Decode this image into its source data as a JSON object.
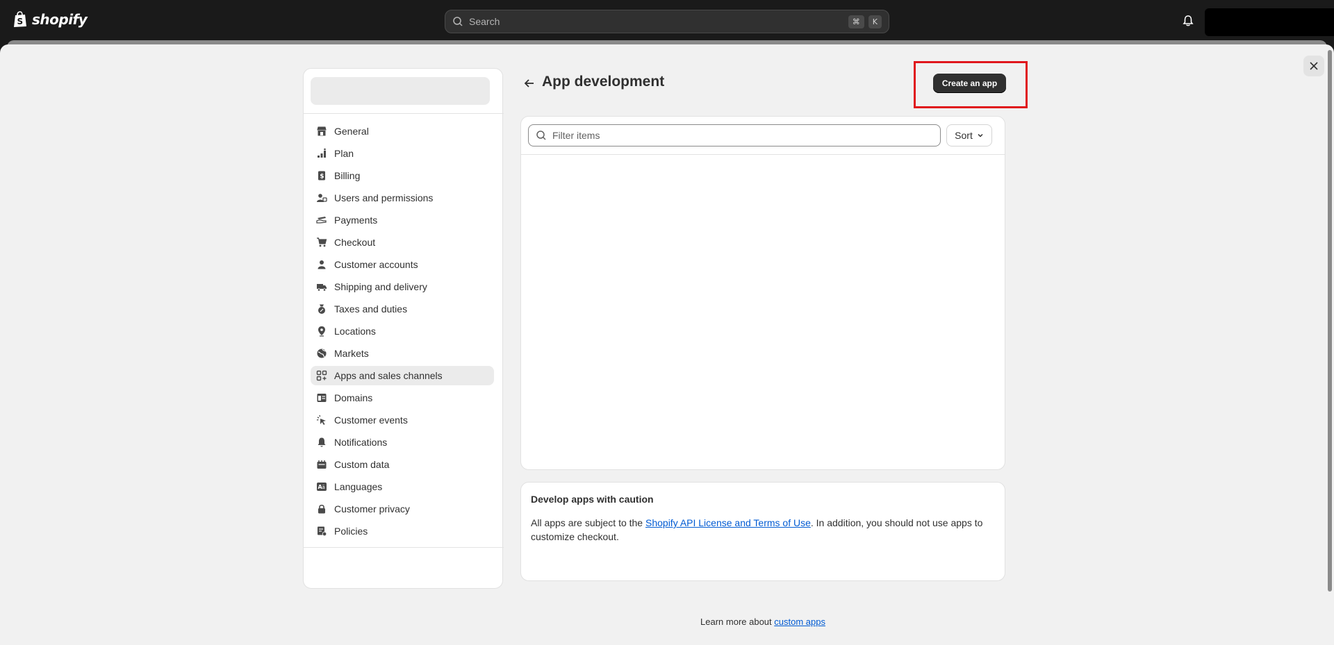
{
  "topbar": {
    "brand": "shopify",
    "search_placeholder": "Search",
    "shortcut_cmd": "⌘",
    "shortcut_key": "K"
  },
  "sidebar": {
    "items": [
      {
        "label": "General",
        "icon": "store-icon"
      },
      {
        "label": "Plan",
        "icon": "plan-chart-icon"
      },
      {
        "label": "Billing",
        "icon": "billing-icon"
      },
      {
        "label": "Users and permissions",
        "icon": "users-icon"
      },
      {
        "label": "Payments",
        "icon": "payments-icon"
      },
      {
        "label": "Checkout",
        "icon": "cart-icon"
      },
      {
        "label": "Customer accounts",
        "icon": "person-icon"
      },
      {
        "label": "Shipping and delivery",
        "icon": "truck-icon"
      },
      {
        "label": "Taxes and duties",
        "icon": "tax-bag-icon"
      },
      {
        "label": "Locations",
        "icon": "location-pin-icon"
      },
      {
        "label": "Markets",
        "icon": "globe-icon"
      },
      {
        "label": "Apps and sales channels",
        "icon": "apps-grid-icon",
        "active": true
      },
      {
        "label": "Domains",
        "icon": "domain-icon"
      },
      {
        "label": "Customer events",
        "icon": "cursor-click-icon"
      },
      {
        "label": "Notifications",
        "icon": "bell-icon"
      },
      {
        "label": "Custom data",
        "icon": "database-icon"
      },
      {
        "label": "Languages",
        "icon": "language-icon"
      },
      {
        "label": "Customer privacy",
        "icon": "lock-icon"
      },
      {
        "label": "Policies",
        "icon": "policy-icon"
      }
    ]
  },
  "main": {
    "title": "App development",
    "create_button": "Create an app",
    "filter_placeholder": "Filter items",
    "sort_label": "Sort",
    "caution": {
      "title": "Develop apps with caution",
      "body_prefix": "All apps are subject to the ",
      "link_text": "Shopify API License and Terms of Use",
      "body_suffix": ". In addition, you should not use apps to customize checkout."
    },
    "footer_prefix": "Learn more about ",
    "footer_link": "custom apps"
  },
  "colors": {
    "highlight": "#e0161c",
    "link": "#005bd3",
    "primary_button": "#303030"
  }
}
